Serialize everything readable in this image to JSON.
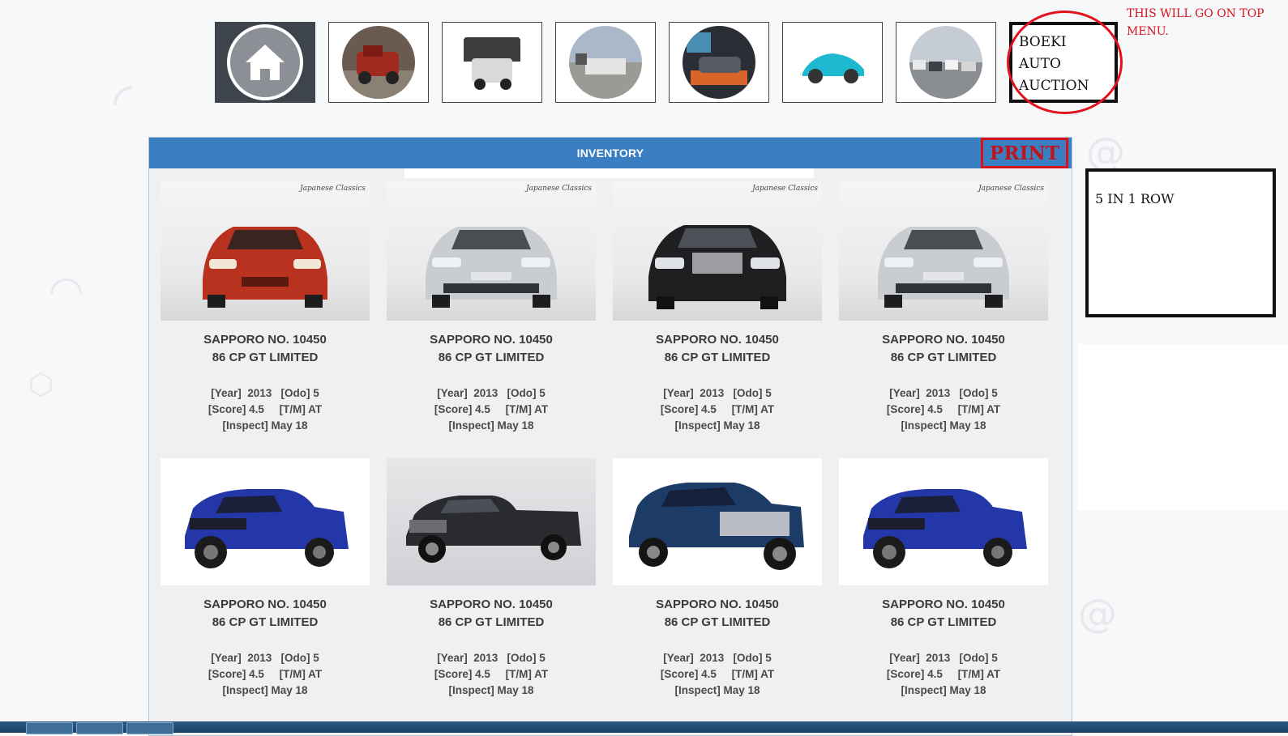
{
  "nav": {
    "tiles": [
      {
        "name": "home",
        "icon": "home-icon"
      },
      {
        "name": "classic-truck"
      },
      {
        "name": "scrap-cars"
      },
      {
        "name": "car-yard"
      },
      {
        "name": "garage-car"
      },
      {
        "name": "blue-sports-car"
      },
      {
        "name": "car-lot"
      }
    ],
    "brand_text": "BOEKI AUTO AUCTION",
    "top_note": "THIS  WILL GO ON TOP MENU."
  },
  "inventory": {
    "title": "INVENTORY",
    "print_label": "PRINT",
    "brand_mark": "Japanese Classics",
    "cards": [
      {
        "line1": "SAPPORO NO. 10450",
        "line2": "86 CP GT LIMITED",
        "specs1": "[Year]  2013   [Odo] 5",
        "specs2": "[Score] 4.5     [T/M] AT",
        "specs3": "[Inspect] May 18",
        "vehicle": "red-sedan"
      },
      {
        "line1": "SAPPORO NO. 10450",
        "line2": "86 CP GT LIMITED",
        "specs1": "[Year]  2013   [Odo] 5",
        "specs2": "[Score] 4.5     [T/M] AT",
        "specs3": "[Inspect] May 18",
        "vehicle": "silver-sedan"
      },
      {
        "line1": "SAPPORO NO. 10450",
        "line2": "86 CP GT LIMITED",
        "specs1": "[Year]  2013   [Odo] 5",
        "specs2": "[Score] 4.5     [T/M] AT",
        "specs3": "[Inspect] May 18",
        "vehicle": "black-sedan"
      },
      {
        "line1": "SAPPORO NO. 10450",
        "line2": "86 CP GT LIMITED",
        "specs1": "[Year]  2013   [Odo] 5",
        "specs2": "[Score] 4.5     [T/M] AT",
        "specs3": "[Inspect] May 18",
        "vehicle": "silver-sedan"
      },
      {
        "line1": "SAPPORO NO. 10450",
        "line2": "86 CP GT LIMITED",
        "specs1": "[Year]  2013   [Odo] 5",
        "specs2": "[Score] 4.5     [T/M] AT",
        "specs3": "[Inspect] May 18",
        "vehicle": "blue-pickup"
      },
      {
        "line1": "SAPPORO NO. 10450",
        "line2": "86 CP GT LIMITED",
        "specs1": "[Year]  2013   [Odo] 5",
        "specs2": "[Score] 4.5     [T/M] AT",
        "specs3": "[Inspect] May 18",
        "vehicle": "black-pickup"
      },
      {
        "line1": "SAPPORO NO. 10450",
        "line2": "86 CP GT LIMITED",
        "specs1": "[Year]  2013   [Odo] 5",
        "specs2": "[Score] 4.5     [T/M] AT",
        "specs3": "[Inspect] May 18",
        "vehicle": "navy-pickup"
      },
      {
        "line1": "SAPPORO NO. 10450",
        "line2": "86 CP GT LIMITED",
        "specs1": "[Year]  2013   [Odo] 5",
        "specs2": "[Score] 4.5     [T/M] AT",
        "specs3": "[Inspect] May 18",
        "vehicle": "blue-pickup"
      }
    ]
  },
  "side_note": "5 IN 1 ROW",
  "colors": {
    "header": "#3a7fc1",
    "annotation_red": "#d8121c",
    "panel_bg": "#eff0f1"
  }
}
